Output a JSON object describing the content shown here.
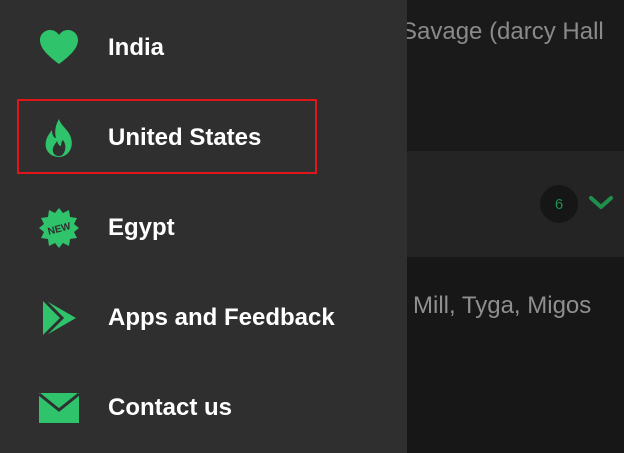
{
  "drawer": {
    "items": [
      {
        "label": "India",
        "icon": "heart-icon"
      },
      {
        "label": "United States",
        "icon": "flame-icon",
        "highlighted": true
      },
      {
        "label": "Egypt",
        "icon": "new-badge-icon",
        "badge_text": "NEW"
      },
      {
        "label": "Apps and Feedback",
        "icon": "play-store-icon"
      },
      {
        "label": "Contact us",
        "icon": "mail-icon"
      }
    ]
  },
  "background": {
    "row1_text": "Savage (darcy Hall",
    "row2_count": "6",
    "row3_text": "Mill, Tyga, Migos"
  },
  "colors": {
    "accent": "#2fc36b",
    "drawer_bg": "#2f2f2f",
    "highlight_border": "#e0161b"
  }
}
